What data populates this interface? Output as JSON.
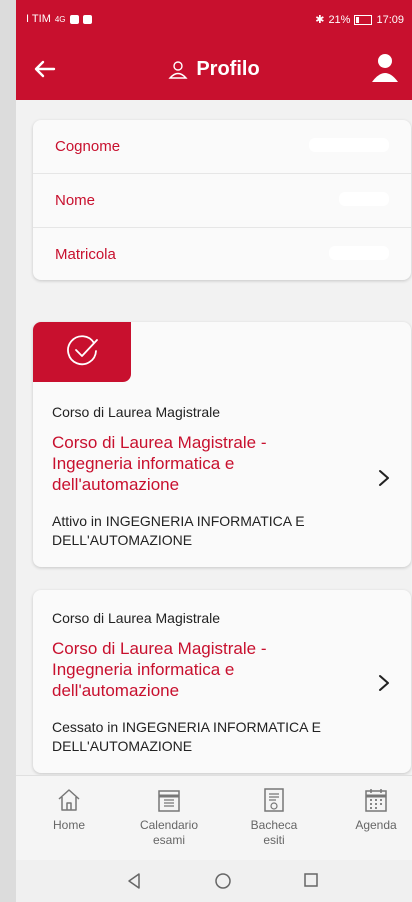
{
  "statusbar": {
    "carrier": "I TIM",
    "signal": "4G",
    "battery": "21%",
    "time": "17:09"
  },
  "appbar": {
    "title": "Profilo"
  },
  "profile": {
    "fields": [
      {
        "label": "Cognome"
      },
      {
        "label": "Nome"
      },
      {
        "label": "Matricola"
      }
    ]
  },
  "careers": [
    {
      "type": "Corso di Laurea Magistrale",
      "name": "Corso di Laurea Magistrale - Ingegneria informatica e dell'automazione",
      "status": "Attivo in INGEGNERIA INFORMATICA E DELL'AUTOMAZIONE",
      "active": true
    },
    {
      "type": "Corso di Laurea Magistrale",
      "name": "Corso di Laurea Magistrale - Ingegneria informatica e dell'automazione",
      "status": "Cessato in INGEGNERIA INFORMATICA E DELL'AUTOMAZIONE",
      "active": false
    }
  ],
  "bottomnav": [
    {
      "label": "Home",
      "icon": "home-icon"
    },
    {
      "label": "Calendario\nesami",
      "icon": "calendar-list-icon"
    },
    {
      "label": "Bacheca\nesiti",
      "icon": "results-board-icon"
    },
    {
      "label": "Agenda",
      "icon": "agenda-icon"
    }
  ],
  "colors": {
    "accent": "#c8102e",
    "background": "#f2f2f2",
    "card": "#fafafa"
  }
}
